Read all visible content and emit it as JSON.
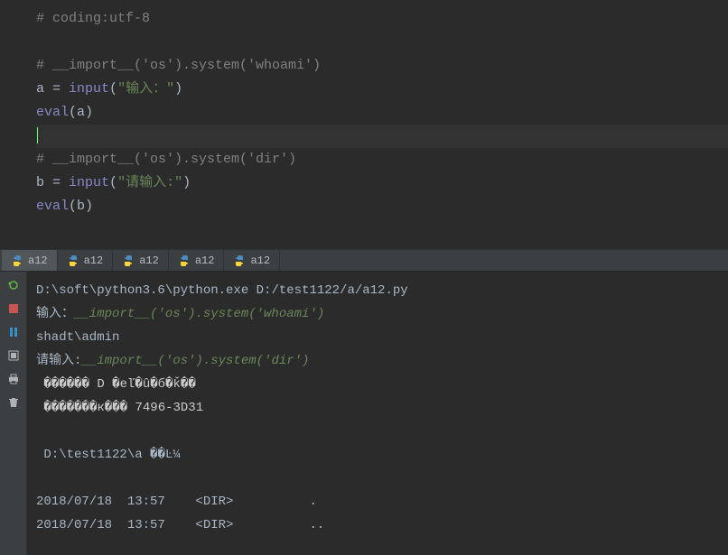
{
  "editor": {
    "lines": {
      "l1_comment": "# coding:utf-8",
      "l3_comment": "# __import__('os').system('whoami')",
      "l4_var": "a",
      "l4_op": " = ",
      "l4_func": "input",
      "l4_str": "\"输入：\"",
      "l5_func": "eval",
      "l5_arg": "a",
      "l7_comment": "# __import__('os').system('dir')",
      "l8_var": "b",
      "l8_op": " = ",
      "l8_func": "input",
      "l8_str": "\"请输入:\"",
      "l9_func": "eval",
      "l9_arg": "b"
    }
  },
  "tabs": [
    {
      "label": "a12"
    },
    {
      "label": "a12"
    },
    {
      "label": "a12"
    },
    {
      "label": "a12"
    },
    {
      "label": "a12"
    }
  ],
  "console": {
    "exec_path": "D:\\soft\\python3.6\\python.exe D:/test1122/a/a12.py",
    "prompt1_label": "输入：",
    "prompt1_input": "__import__('os').system('whoami')",
    "output1": "shadt\\admin",
    "prompt2_label": "请输入:",
    "prompt2_input": "__import__('os').system('dir')",
    "garbled1": " ������ D �еľ�û�б�ǩ��",
    "garbled2": " �������к��� 7496-3D31",
    "dir_path": " D:\\test1122\\a ��Ŀ¼",
    "entry1": "2018/07/18  13:57    <DIR>          .",
    "entry2": "2018/07/18  13:57    <DIR>          .."
  },
  "icons": {
    "python": "python-icon",
    "rerun": "rerun-icon",
    "stop": "stop-icon",
    "pause": "pause-icon",
    "restore": "restore-icon",
    "trash": "trash-icon"
  }
}
